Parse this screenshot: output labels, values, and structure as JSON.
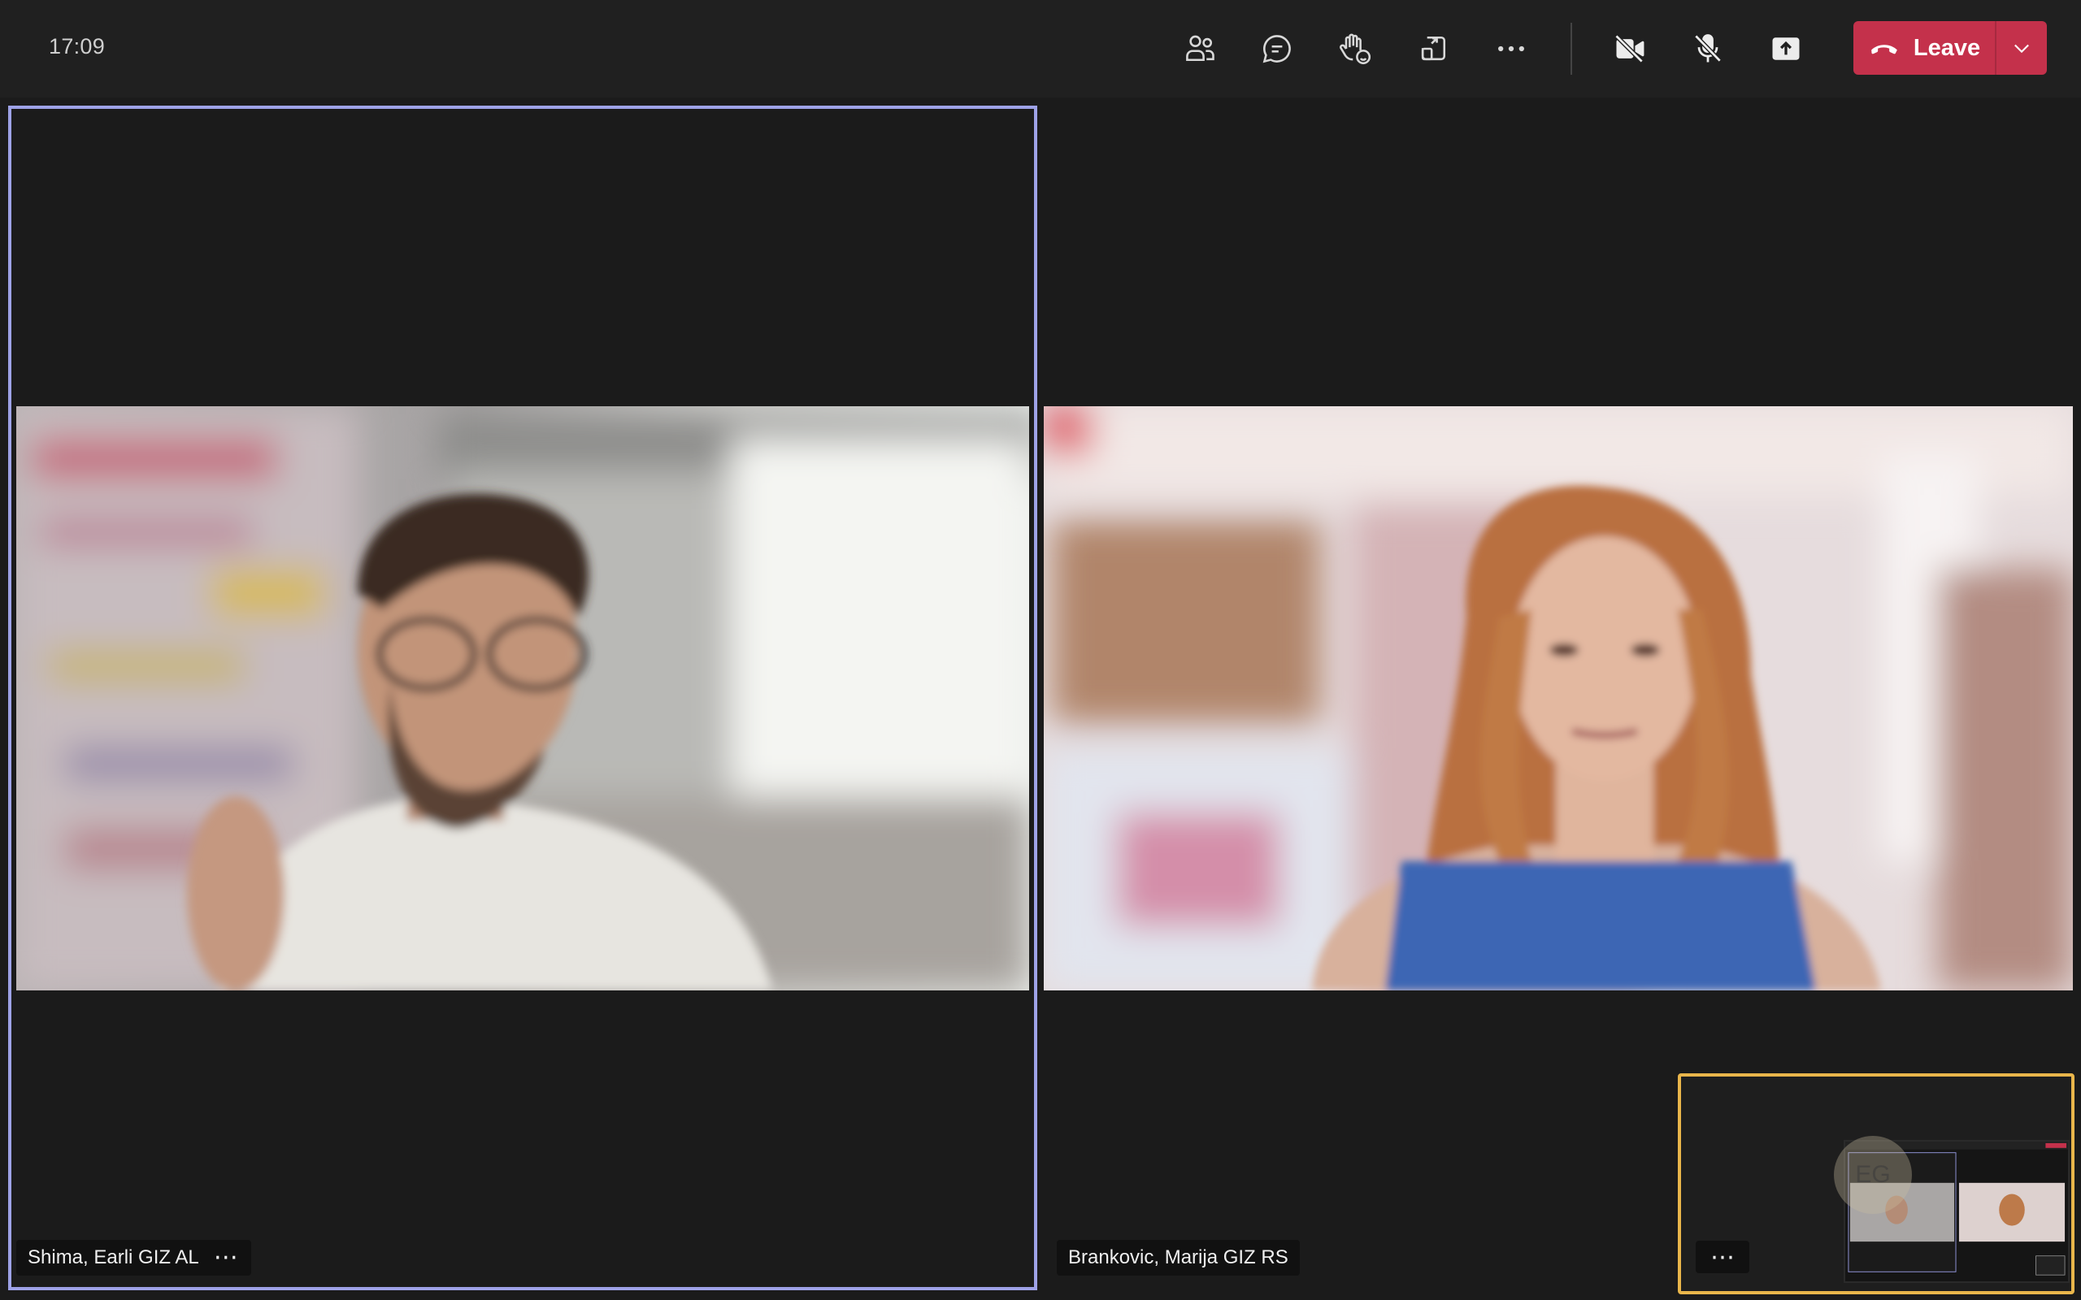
{
  "meeting": {
    "time": "17:09"
  },
  "toolbar": {
    "people_icon": "people-icon",
    "chat_icon": "chat-icon",
    "reactions_icon": "raise-hand-react-icon",
    "rooms_icon": "breakout-rooms-icon",
    "more_icon": "more-actions-icon",
    "camera_icon": "camera-off-icon",
    "mic_icon": "mic-off-icon",
    "share_icon": "share-tray-icon",
    "leave_label": "Leave",
    "leave_color": "#c4314b"
  },
  "participants": [
    {
      "name": "Shima, Earli GIZ AL",
      "active_speaker": true,
      "accent": "#9ea2e7"
    },
    {
      "name": "Brankovic, Marija GIZ RS",
      "active_speaker": false
    }
  ],
  "self_view": {
    "accent": "#e9b64b",
    "initials": "EG"
  }
}
